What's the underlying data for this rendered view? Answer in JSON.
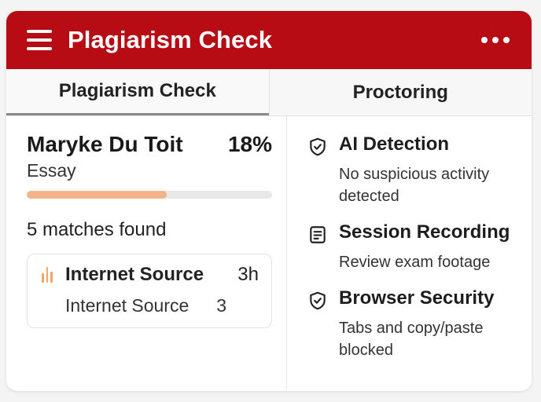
{
  "header": {
    "title": "Plagiarism Check",
    "menu_icon": "hamburger-menu-icon",
    "more_icon": "more-horizontal-icon"
  },
  "tabs": [
    {
      "label": "Plagiarism Check",
      "active": true
    },
    {
      "label": "Proctoring",
      "active": false
    }
  ],
  "submission": {
    "student_name": "Maryke Du Toit",
    "score": "18%",
    "document_type": "Essay",
    "similarity_fraction": 0.57,
    "matches_text": "5 matches found"
  },
  "source": {
    "icon": "bar-chart-icon",
    "name": "Internet Source",
    "age": "3h",
    "sub_name": "Internet Source",
    "count": "3"
  },
  "proctoring": [
    {
      "icon": "shield-check-icon",
      "title": "AI Detection",
      "description": "No suspicious activity detected"
    },
    {
      "icon": "document-list-icon",
      "title": "Session Recording",
      "description": "Review exam footage"
    },
    {
      "icon": "shield-check-icon",
      "title": "Browser Security",
      "description": "Tabs and copy/paste blocked"
    }
  ],
  "colors": {
    "brand_red": "#b70c14",
    "progress_fill": "#f2b488",
    "source_accent": "#f0a766"
  }
}
